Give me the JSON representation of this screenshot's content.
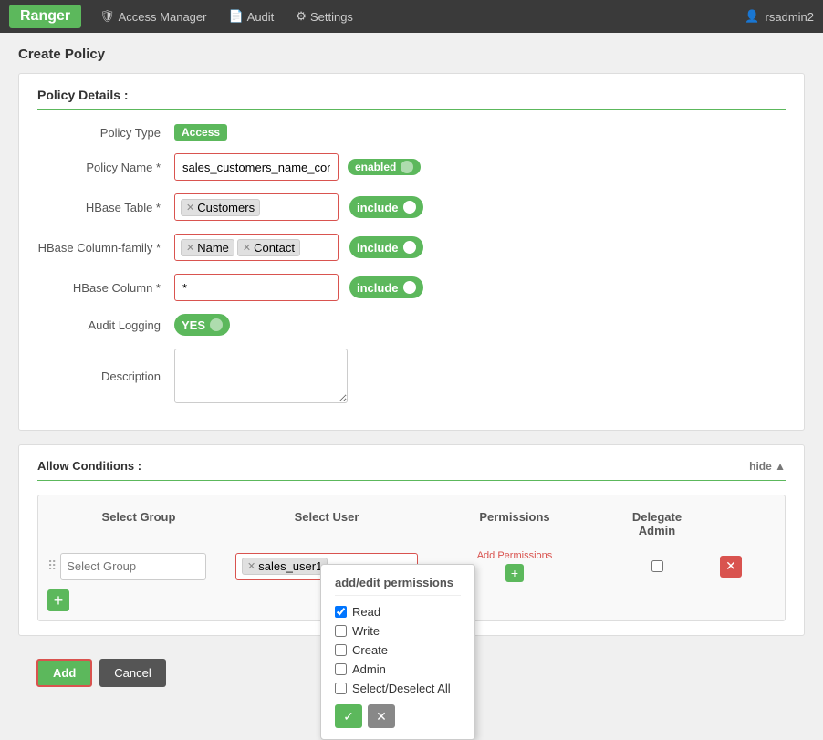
{
  "topnav": {
    "brand": "Ranger",
    "items": [
      {
        "label": "Access Manager",
        "icon": "shield-icon"
      },
      {
        "label": "Audit",
        "icon": "audit-icon"
      },
      {
        "label": "Settings",
        "icon": "settings-icon"
      }
    ],
    "user": "rsadmin2",
    "user_icon": "user-icon"
  },
  "page": {
    "title": "Create Policy"
  },
  "policy_details": {
    "section_title": "Policy Details :",
    "policy_type_label": "Policy Type",
    "policy_type_value": "Access",
    "policy_name_label": "Policy Name *",
    "policy_name_value": "sales_customers_name_contact",
    "policy_name_placeholder": "",
    "enabled_label": "enabled",
    "hbase_table_label": "HBase Table *",
    "hbase_table_tag": "Customers",
    "hbase_table_include": "include",
    "hbase_column_family_label": "HBase Column-family *",
    "hbase_column_family_tags": [
      "Name",
      "Contact"
    ],
    "hbase_column_family_include": "include",
    "hbase_column_label": "HBase Column *",
    "hbase_column_value": "*",
    "hbase_column_include": "include",
    "audit_logging_label": "Audit Logging",
    "audit_logging_value": "YES",
    "description_label": "Description"
  },
  "allow_conditions": {
    "section_title": "Allow Conditions :",
    "hide_label": "hide ▲",
    "table_headers": [
      "Select Group",
      "Select User",
      "Permissions",
      "Delegate Admin",
      ""
    ],
    "rows": [
      {
        "group_placeholder": "Select Group",
        "user_tag": "sales_user1",
        "permissions_label": "Add Permissions",
        "delegate_admin": false
      }
    ],
    "add_row_btn": "+"
  },
  "popup": {
    "title": "add/edit permissions",
    "options": [
      {
        "label": "Read",
        "checked": true
      },
      {
        "label": "Write",
        "checked": false
      },
      {
        "label": "Create",
        "checked": false
      },
      {
        "label": "Admin",
        "checked": false
      },
      {
        "label": "Select/Deselect All",
        "checked": false
      }
    ],
    "ok_icon": "✓",
    "cancel_icon": "✕"
  },
  "bottom": {
    "add_label": "Add",
    "cancel_label": "Cancel"
  }
}
